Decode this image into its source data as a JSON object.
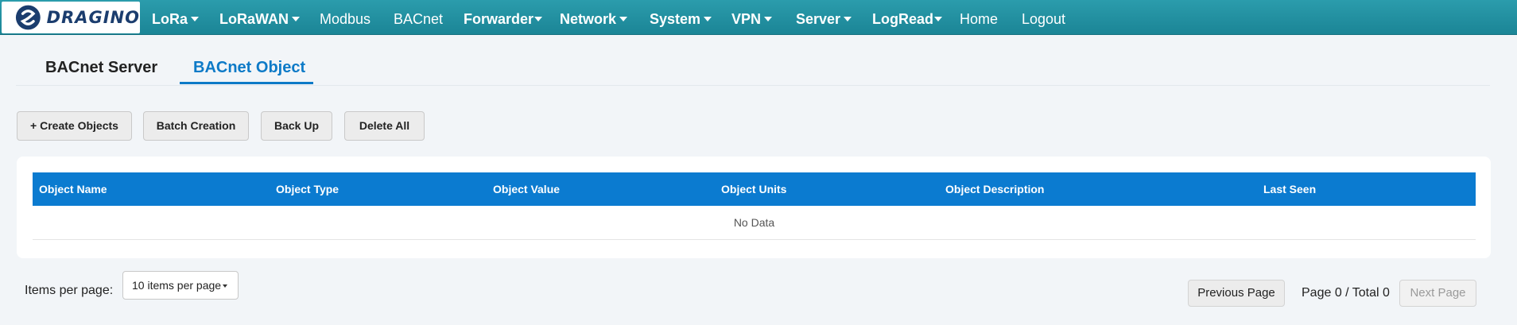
{
  "brand": {
    "name": "DRAGINO",
    "logo_color": "#1b3d6e"
  },
  "nav": {
    "lora": "LoRa",
    "lorawan": "LoRaWAN",
    "modbus": "Modbus",
    "bacnet": "BACnet",
    "forwarder": "Forwarder",
    "network": "Network",
    "system": "System",
    "vpn": "VPN",
    "server": "Server",
    "logread": "LogRead",
    "home": "Home",
    "logout": "Logout"
  },
  "tabs": {
    "server": "BACnet Server",
    "object": "BACnet Object"
  },
  "actions": {
    "create": "+ Create Objects",
    "batch": "Batch Creation",
    "backup": "Back Up",
    "delete_all": "Delete All"
  },
  "table": {
    "columns": [
      "Object Name",
      "Object Type",
      "Object Value",
      "Object Units",
      "Object Description",
      "Last Seen"
    ],
    "empty_text": "No Data"
  },
  "pagination": {
    "items_label": "Items per page:",
    "items_selected": "10 items per page",
    "prev": "Previous Page",
    "info": "Page 0 / Total 0",
    "next": "Next Page"
  },
  "colors": {
    "nav_bg": "#1b8596",
    "accent": "#0b7bd0",
    "active_tab": "#0d7ac7"
  }
}
